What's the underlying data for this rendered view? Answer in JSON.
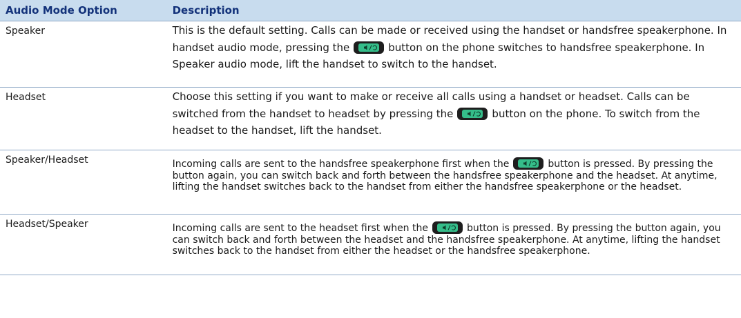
{
  "table": {
    "headers": {
      "mode": "Audio Mode Option",
      "description": "Description"
    },
    "rows": [
      {
        "mode": "Speaker",
        "desc_before": "This is the default setting. Calls can be made or received using the handset or handsfree speakerphone. In handset audio mode, pressing the",
        "desc_after": "button on the phone switches to handsfree speakerphone. In Speaker audio mode, lift the handset to switch to the handset."
      },
      {
        "mode": "Headset",
        "desc_before": "Choose this setting if you want to make or receive all calls using a handset or headset. Calls can be switched from the handset to headset by pressing the",
        "desc_after": "button on the phone. To switch from the headset to the handset, lift the handset."
      },
      {
        "mode": "Speaker/Headset",
        "desc_before": "Incoming calls are sent to the handsfree speakerphone first when the",
        "desc_after": "button is pressed. By pressing the button again, you can switch back and forth between the handsfree speakerphone and the headset. At anytime, lifting the handset switches back to the handset from either the handsfree speakerphone or the headset."
      },
      {
        "mode": "Headset/Speaker",
        "desc_before": "Incoming calls are sent to the headset first when the",
        "desc_after": "button is pressed. By pressing the button again, you can switch back and forth between the headset and the handsfree speakerphone. At anytime, lifting the handset switches back to the handset from either the headset or the handsfree speakerphone."
      }
    ]
  },
  "icons": {
    "button_icon": "speaker-headset-key-icon"
  },
  "colors": {
    "header_bg": "#c8dcee",
    "header_text": "#13327a",
    "rule": "#8fa9c6",
    "key_body": "#1e1e1e",
    "key_face": "#35bd8a"
  }
}
